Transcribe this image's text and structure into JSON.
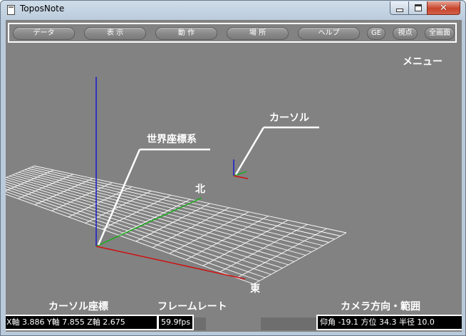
{
  "window": {
    "title": "ToposNote",
    "close_glyph": "✕"
  },
  "toolbar": {
    "buttons": [
      "データ",
      "表 示",
      "動 作",
      "場 所",
      "ヘルプ",
      "GE",
      "視点",
      "全画面"
    ]
  },
  "labels": {
    "menu": "メニュー",
    "cursor": "カーソル",
    "world_axes": "世界座標系",
    "north": "北",
    "east": "東",
    "cursor_coords": "カーソル座標",
    "frame_rate": "フレームレート",
    "camera": "カメラ方向・範囲"
  },
  "status": {
    "coords": "X軸  3.886 Y軸  7.855 Z軸  2.675",
    "fps": "59.9fps",
    "camera": "仰角 -19.1 方位  34.3 半径  10.0"
  },
  "colors": {
    "background": "#828282",
    "x_axis": "#d01010",
    "y_axis": "#10b010",
    "z_axis": "#1a1acc",
    "grid": "#ffffff"
  }
}
